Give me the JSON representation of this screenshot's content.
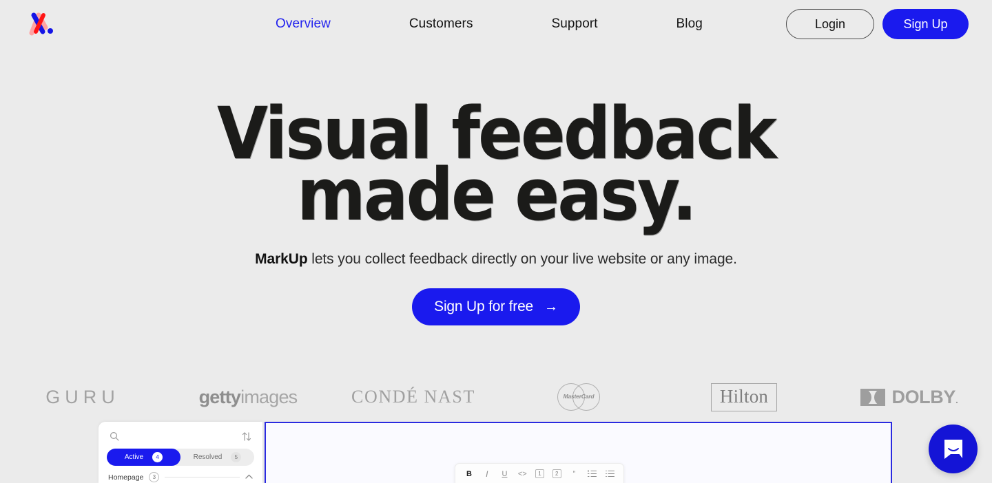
{
  "brand": {
    "name": "MarkUp",
    "logo_icon": "markup-m-logo",
    "accent_blue": "#1a1aee",
    "logo_pink": "#ff9c9c",
    "logo_red": "#ff1414",
    "background": "#ebebeb"
  },
  "nav": {
    "items": [
      {
        "label": "Overview",
        "active": true
      },
      {
        "label": "Customers",
        "active": false
      },
      {
        "label": "Support",
        "active": false
      },
      {
        "label": "Blog",
        "active": false
      }
    ],
    "login_label": "Login",
    "signup_label": "Sign Up"
  },
  "hero": {
    "headline_line1": "Visual feedback",
    "headline_line2": "made easy.",
    "subtitle_brand": "MarkUp",
    "subtitle_rest": " lets you collect feedback directly on your live website or any image.",
    "cta_label": "Sign Up for free",
    "cta_arrow": "→"
  },
  "logo_strip": {
    "items": [
      {
        "name": "guru",
        "text": "GURU"
      },
      {
        "name": "gettyimages",
        "text_bold": "getty",
        "text_light": "images"
      },
      {
        "name": "conde-nast",
        "text": "CONDÉ NAST"
      },
      {
        "name": "mastercard",
        "text": "MasterCard"
      },
      {
        "name": "hilton",
        "text": "Hilton"
      },
      {
        "name": "dolby",
        "text": "DOLBY",
        "suffix": "."
      }
    ]
  },
  "app_preview": {
    "sidebar": {
      "search_icon": "search-icon",
      "sort_icon": "sort-arrows-icon",
      "tabs": [
        {
          "label": "Active",
          "count": "4",
          "selected": true
        },
        {
          "label": "Resolved",
          "count": "5",
          "selected": false
        }
      ],
      "group": {
        "label": "Homepage",
        "count": "3",
        "chevron": "˄"
      }
    },
    "toolbar": {
      "bold": "B",
      "italic": "I",
      "underline": "U",
      "code": "<>",
      "heading1": "1",
      "heading2": "2",
      "quote": "”",
      "ordered_list": "ordered-list-icon",
      "bullet_list": "bullet-list-icon"
    }
  },
  "chat": {
    "launcher_icon": "intercom-chat-icon"
  }
}
